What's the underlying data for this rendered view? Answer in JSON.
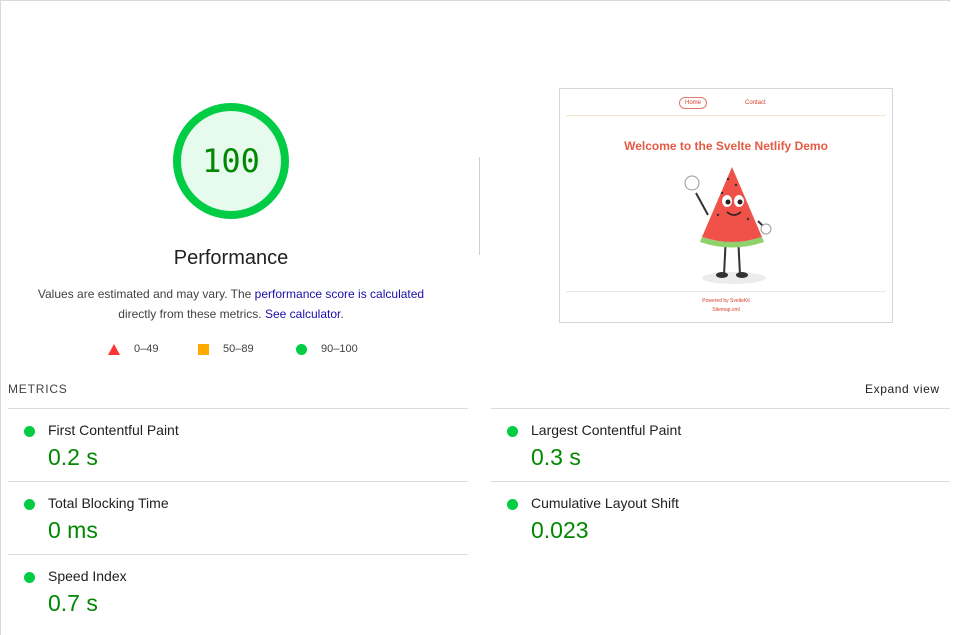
{
  "score": {
    "value": "100",
    "category": "Performance",
    "color": "#00cc44",
    "fill": 1.0
  },
  "description": {
    "prefix": "Values are estimated and may vary. The ",
    "link1": "performance score is calculated",
    "middle": "directly from these metrics.",
    "link2": "See calculator",
    "suffix": "."
  },
  "legend": [
    {
      "icon": "triangle-icon",
      "range": "0–49",
      "color": "#ff3333"
    },
    {
      "icon": "square-icon",
      "range": "50–89",
      "color": "#ffaa00"
    },
    {
      "icon": "circle-icon",
      "range": "90–100",
      "color": "#00cc44"
    }
  ],
  "preview": {
    "nav_home": "Home",
    "nav_contact": "Contact",
    "title": "Welcome to the Svelte Netlify Demo",
    "powered": "Powered by SvelteKit",
    "sitemap": "Sitemap.xml",
    "accent": "#e45b43"
  },
  "metrics": {
    "header": "METRICS",
    "expand": "Expand view",
    "items": [
      {
        "title": "First Contentful Paint",
        "value": "0.2 s"
      },
      {
        "title": "Largest Contentful Paint",
        "value": "0.3 s"
      },
      {
        "title": "Total Blocking Time",
        "value": "0 ms"
      },
      {
        "title": "Cumulative Layout Shift",
        "value": "0.023"
      },
      {
        "title": "Speed Index",
        "value": "0.7 s"
      }
    ]
  }
}
